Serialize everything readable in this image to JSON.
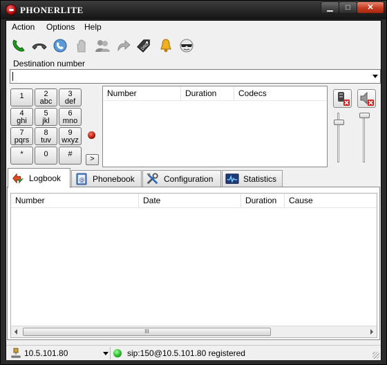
{
  "window": {
    "title": "PHONERLITE",
    "min_symbol": "▁",
    "max_symbol": "□",
    "close_symbol": "✕"
  },
  "menu": [
    {
      "label": "Action"
    },
    {
      "label": "Options"
    },
    {
      "label": "Help"
    }
  ],
  "toolbar": [
    {
      "icon": "call-icon"
    },
    {
      "icon": "hangup-icon"
    },
    {
      "icon": "redial-icon"
    },
    {
      "icon": "hold-icon"
    },
    {
      "icon": "conference-icon"
    },
    {
      "icon": "transfer-icon"
    },
    {
      "icon": "dnd-tag-icon"
    },
    {
      "icon": "bell-icon"
    },
    {
      "icon": "anonymous-icon"
    }
  ],
  "destination": {
    "label": "Destination number",
    "value": ""
  },
  "keypad": [
    {
      "digit": "1",
      "letters": ""
    },
    {
      "digit": "2",
      "letters": "abc"
    },
    {
      "digit": "3",
      "letters": "def"
    },
    {
      "digit": "4",
      "letters": "ghi"
    },
    {
      "digit": "5",
      "letters": "jkl"
    },
    {
      "digit": "6",
      "letters": "mno"
    },
    {
      "digit": "7",
      "letters": "pqrs"
    },
    {
      "digit": "8",
      "letters": "tuv"
    },
    {
      "digit": "9",
      "letters": "wxyz"
    },
    {
      "digit": "*",
      "letters": ""
    },
    {
      "digit": "0",
      "letters": ""
    },
    {
      "digit": "#",
      "letters": ""
    }
  ],
  "more_button": ">",
  "calls_table": {
    "columns": [
      "Number",
      "Duration",
      "Codecs"
    ],
    "rows": []
  },
  "tabs": [
    {
      "label": "Logbook",
      "icon": "logbook-icon",
      "active": true
    },
    {
      "label": "Phonebook",
      "icon": "phonebook-icon",
      "active": false
    },
    {
      "label": "Configuration",
      "icon": "configuration-icon",
      "active": false
    },
    {
      "label": "Statistics",
      "icon": "statistics-icon",
      "active": false
    }
  ],
  "logbook": {
    "columns": [
      "Number",
      "Date",
      "Duration",
      "Cause"
    ],
    "rows": [],
    "scroll_thumb": "III"
  },
  "status": {
    "ip": "10.5.101.80",
    "registration": "sip:150@10.5.101.80 registered",
    "led_color": "#20b020"
  },
  "colors": {
    "led_red": "#aa1500",
    "titlebar": "#141414",
    "close_button": "#c43b1f"
  }
}
